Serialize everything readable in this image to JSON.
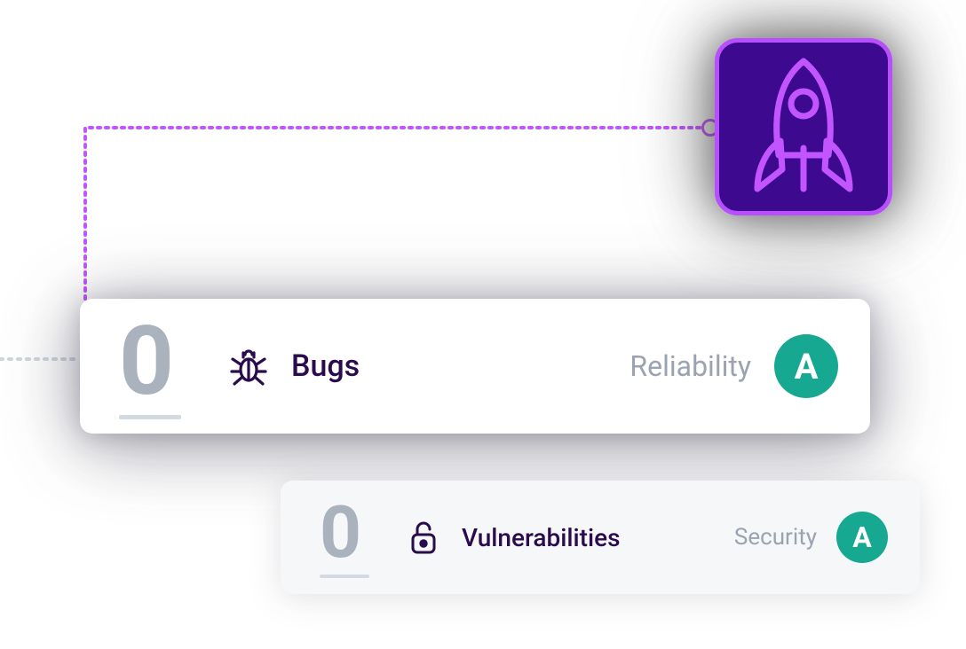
{
  "rocket": {
    "icon_name": "rocket-icon",
    "badge_color": "#3d0a8f",
    "badge_border": "#b84fff",
    "icon_stroke": "#c255ff"
  },
  "connector": {
    "line_color": "#c255ff",
    "secondary_line_color": "#cfd6df"
  },
  "metrics": {
    "bugs": {
      "count": "0",
      "label": "Bugs",
      "category": "Reliability",
      "grade": "A",
      "grade_color": "#16a890",
      "icon_name": "bug-icon"
    },
    "vulnerabilities": {
      "count": "0",
      "label": "Vulnerabilities",
      "category": "Security",
      "grade": "A",
      "grade_color": "#16a890",
      "icon_name": "unlock-icon"
    }
  }
}
